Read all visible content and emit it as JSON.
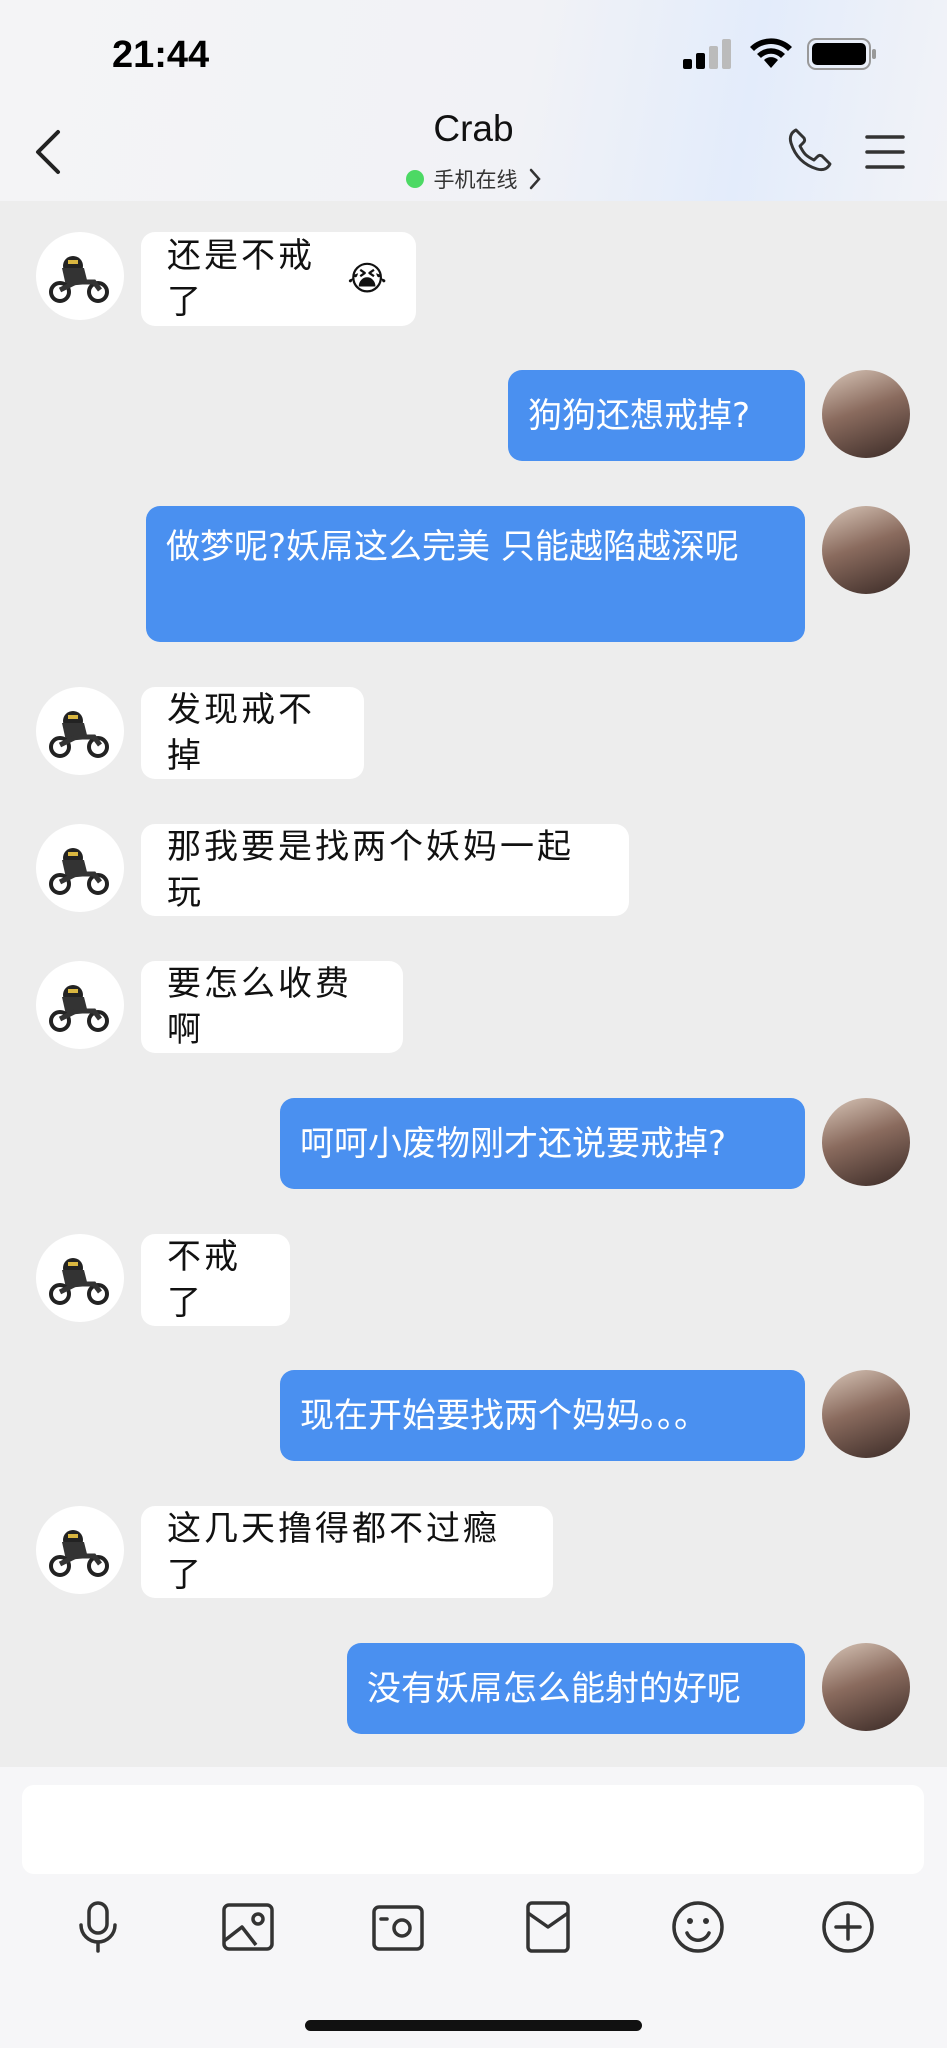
{
  "status_bar": {
    "time": "21:44"
  },
  "header": {
    "title": "Crab",
    "subtitle": "手机在线"
  },
  "messages": [
    {
      "side": "in",
      "text": "还是不戒了",
      "emoji": "😭"
    },
    {
      "side": "out",
      "text": "狗狗还想戒掉?"
    },
    {
      "side": "out",
      "text": "做梦呢?妖屌这么完美 只能越陷越深呢"
    },
    {
      "side": "in",
      "text": "发现戒不掉"
    },
    {
      "side": "in",
      "text": "那我要是找两个妖妈一起玩"
    },
    {
      "side": "in",
      "text": "要怎么收费啊"
    },
    {
      "side": "out",
      "text": "呵呵小废物刚才还说要戒掉?"
    },
    {
      "side": "in",
      "text": "不戒了"
    },
    {
      "side": "out",
      "text": "现在开始要找两个妈妈。。。"
    },
    {
      "side": "in",
      "text": "这几天撸得都不过瘾了"
    },
    {
      "side": "out",
      "text": "没有妖屌怎么能射的好呢"
    }
  ],
  "toolbar": {
    "icons": [
      "microphone-icon",
      "image-icon",
      "camera-icon",
      "red-packet-icon",
      "emoji-icon",
      "plus-icon"
    ]
  },
  "colors": {
    "accent": "#4a90f0",
    "online": "#4cd964",
    "background": "#ededed"
  }
}
